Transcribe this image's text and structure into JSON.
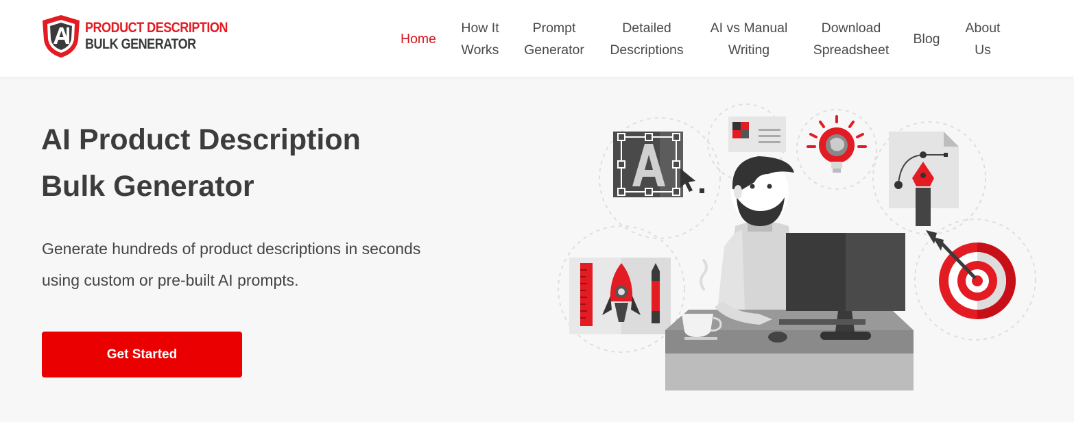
{
  "brand": {
    "line1": "PRODUCT DESCRIPTION",
    "line2": "BULK GENERATOR",
    "mark": "AI",
    "accent": "#e31b23"
  },
  "nav": [
    {
      "label": "Home",
      "active": true
    },
    {
      "label": "How It\nWorks",
      "active": false
    },
    {
      "label": "Prompt\nGenerator",
      "active": false
    },
    {
      "label": "Detailed\nDescriptions",
      "active": false
    },
    {
      "label": "AI vs Manual\nWriting",
      "active": false
    },
    {
      "label": "Download\nSpreadsheet",
      "active": false
    },
    {
      "label": "Blog",
      "active": false
    },
    {
      "label": "About\nUs",
      "active": false
    }
  ],
  "hero": {
    "title_line1": "AI Product Description",
    "title_line2": "Bulk Generator",
    "subtitle_line1": "Generate hundreds of product descriptions in seconds",
    "subtitle_line2": "using custom or pre-built AI prompts.",
    "cta_label": "Get Started",
    "cta_color": "#ea0000"
  },
  "illustration": {
    "icons": [
      "typography-icon",
      "image-card-icon",
      "idea-bulb-icon",
      "pen-tool-icon",
      "target-icon",
      "rocket-icon",
      "coffee-cup-icon",
      "monitor-icon"
    ]
  }
}
